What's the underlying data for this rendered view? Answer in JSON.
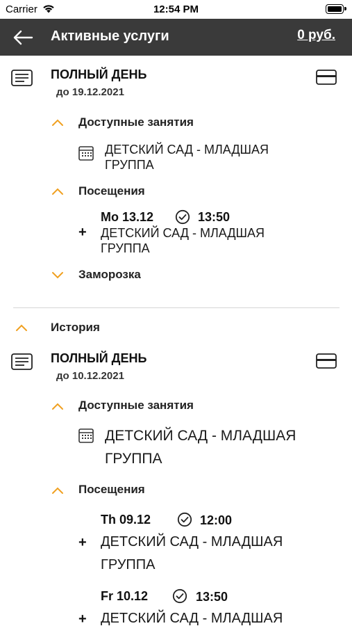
{
  "status_bar": {
    "carrier": "Carrier",
    "time": "12:54 PM"
  },
  "navbar": {
    "title": "Активные услуги",
    "balance": "0 руб.",
    "back_icon": "arrow-left-icon"
  },
  "colors": {
    "navbar_bg": "#3a3a3a",
    "accent_chevron": "#f0a020",
    "text": "#111111"
  },
  "active_service": {
    "name": "ПОЛНЫЙ ДЕНЬ",
    "until": "до 19.12.2021",
    "available_label": "Доступные занятия",
    "available_items": [
      {
        "line1": "ДЕТСКИЙ САД - МЛАДШАЯ",
        "line2": "ГРУППА"
      }
    ],
    "visits_label": "Посещения",
    "visits": [
      {
        "day": "Mo 13.12",
        "time": "13:50",
        "line1": "ДЕТСКИЙ САД - МЛАДШАЯ",
        "line2": "ГРУППА"
      }
    ],
    "freeze_label": "Заморозка"
  },
  "history": {
    "label": "История",
    "services": [
      {
        "name": "ПОЛНЫЙ ДЕНЬ",
        "until": "до 10.12.2021",
        "available_label": "Доступные занятия",
        "available_items": [
          {
            "line1": "ДЕТСКИЙ САД - МЛАДШАЯ",
            "line2": "ГРУППА"
          }
        ],
        "visits_label": "Посещения",
        "visits": [
          {
            "day": "Th 09.12",
            "time": "12:00",
            "line1": "ДЕТСКИЙ САД - МЛАДШАЯ",
            "line2": "ГРУППА"
          },
          {
            "day": "Fr 10.12",
            "time": "13:50",
            "line1": "ДЕТСКИЙ САД - МЛАДШАЯ",
            "line2": ""
          }
        ]
      }
    ]
  }
}
